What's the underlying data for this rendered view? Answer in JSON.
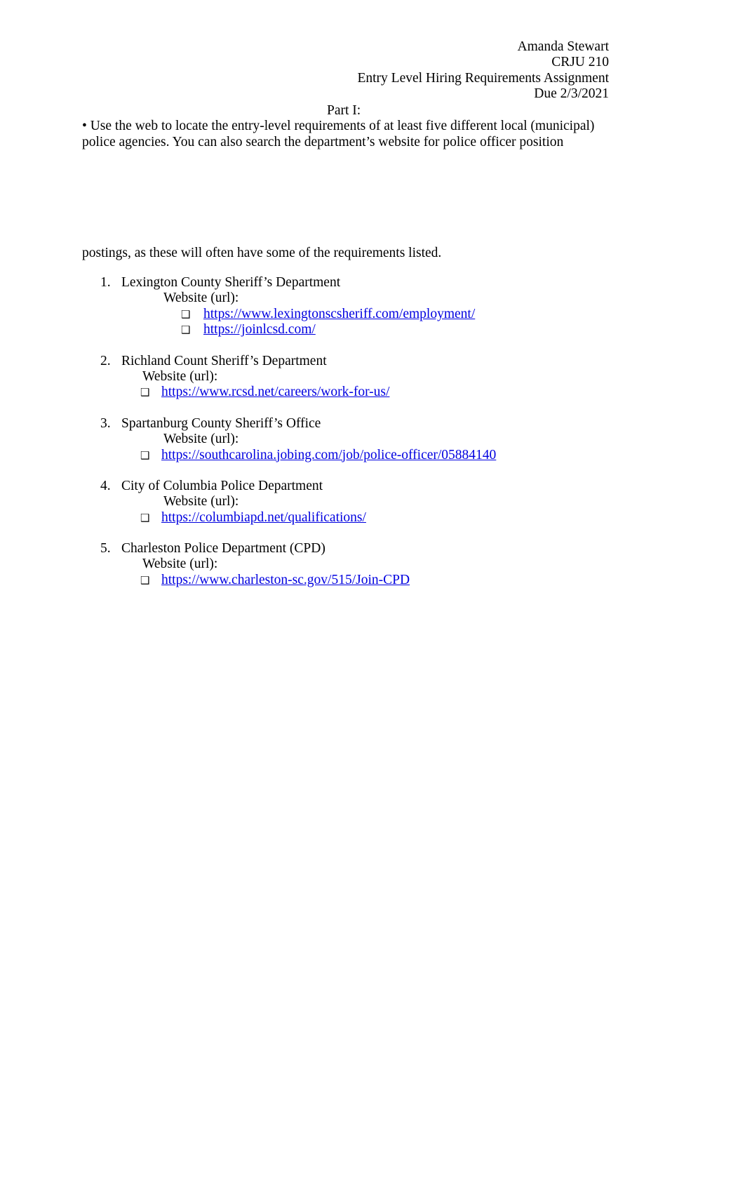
{
  "document": {
    "header": {
      "student_name": "Amanda Stewart",
      "course": "CRJU 210",
      "assignment_title": "Entry Level Hiring Requirements Assignment",
      "due_date": "Due 2/3/2021"
    },
    "part_heading": "Part I:",
    "intro_line_1": "• Use the web to locate the entry-level requirements of at least five different local (municipal)",
    "intro_line_2": "police agencies. You can also search the department’s website for police officer position",
    "continuation_line": "postings, as these will often have some of the requirements listed.",
    "website_label": "Website (url):",
    "agencies": [
      {
        "number": "1.",
        "name": "Lexington County Sheriff’s Department",
        "label": "Website (url):",
        "urls": [
          "https://www.lexingtonscsheriff.com/employment/",
          "https://joinlcsd.com/"
        ]
      },
      {
        "number": "2.",
        "name": "Richland Count Sheriff’s Department",
        "label": "Website (url):",
        "urls": [
          "https://www.rcsd.net/careers/work-for-us/"
        ]
      },
      {
        "number": "3.",
        "name": "Spartanburg County Sheriff’s Office",
        "label": "Website (url):",
        "urls": [
          "https://southcarolina.jobing.com/job/police-officer/05884140"
        ]
      },
      {
        "number": "4.",
        "name": "City of Columbia Police Department",
        "label": "Website (url):",
        "urls": [
          "https://columbiapd.net/qualifications/"
        ]
      },
      {
        "number": "5.",
        "name": "Charleston Police Department (CPD)",
        "label": "Website (url):",
        "urls": [
          "https://www.charleston-sc.gov/515/Join-CPD"
        ]
      }
    ],
    "bullet_glyph": "❑",
    "colors": {
      "text": "#000000",
      "link": "#0000e0",
      "page_background": "#ffffff"
    }
  }
}
